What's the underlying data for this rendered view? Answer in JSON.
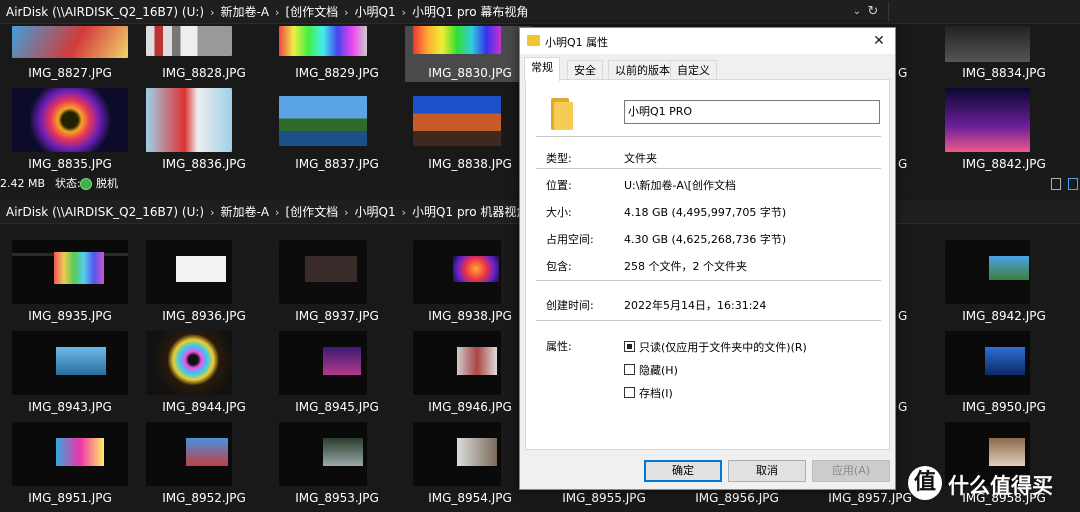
{
  "top_window": {
    "breadcrumbs": [
      "AirDisk (\\\\AIRDISK_Q2_16B7) (U:)",
      "新加卷-A",
      "[创作文档",
      "小明Q1",
      "小明Q1 pro 幕布视角"
    ],
    "files_row1": [
      "IMG_8827.JPG",
      "IMG_8828.JPG",
      "IMG_8829.JPG",
      "IMG_8830.JPG",
      "",
      "",
      "",
      "IMG_8834.JPG"
    ],
    "files_row2": [
      "IMG_8835.JPG",
      "IMG_8836.JPG",
      "IMG_8837.JPG",
      "IMG_8838.JPG",
      "",
      "",
      "",
      "IMG_8842.JPG"
    ],
    "partial_label_g": "G",
    "status": {
      "size": "2.42 MB",
      "state_label": "状态:",
      "offline": "脱机"
    }
  },
  "bottom_window": {
    "breadcrumbs": [
      "AirDisk (\\\\AIRDISK_Q2_16B7) (U:)",
      "新加卷-A",
      "[创作文档",
      "小明Q1",
      "小明Q1 pro 机器视角"
    ],
    "files_row1": [
      "IMG_8935.JPG",
      "IMG_8936.JPG",
      "IMG_8937.JPG",
      "IMG_8938.JPG",
      "",
      "",
      "",
      "IMG_8942.JPG"
    ],
    "files_row2": [
      "IMG_8943.JPG",
      "IMG_8944.JPG",
      "IMG_8945.JPG",
      "IMG_8946.JPG",
      "",
      "",
      "",
      "IMG_8950.JPG"
    ],
    "files_row3": [
      "IMG_8951.JPG",
      "IMG_8952.JPG",
      "IMG_8953.JPG",
      "IMG_8954.JPG",
      "IMG_8955.JPG",
      "IMG_8956.JPG",
      "IMG_8957.JPG",
      "IMG_8958.JPG"
    ],
    "partial_label_g": "G"
  },
  "dialog": {
    "title": "小明Q1 属性",
    "tabs": [
      "常规",
      "安全",
      "以前的版本",
      "自定义"
    ],
    "name": "小明Q1 PRO",
    "props": {
      "type_label": "类型:",
      "type_value": "文件夹",
      "location_label": "位置:",
      "location_value": "U:\\新加卷-A\\[创作文档",
      "size_label": "大小:",
      "size_value": "4.18 GB (4,495,997,705 字节)",
      "disk_label": "占用空间:",
      "disk_value": "4.30 GB (4,625,268,736 字节)",
      "contains_label": "包含:",
      "contains_value": "258 个文件，2 个文件夹",
      "created_label": "创建时间:",
      "created_value": "2022年5月14日，16:31:24",
      "attr_label": "属性:"
    },
    "attributes": [
      "只读(仅应用于文件夹中的文件)(R)",
      "隐藏(H)",
      "存档(I)"
    ],
    "buttons": {
      "ok": "确定",
      "cancel": "取消",
      "apply": "应用(A)"
    }
  },
  "watermark": {
    "badge": "值",
    "text": "什么值得买"
  }
}
